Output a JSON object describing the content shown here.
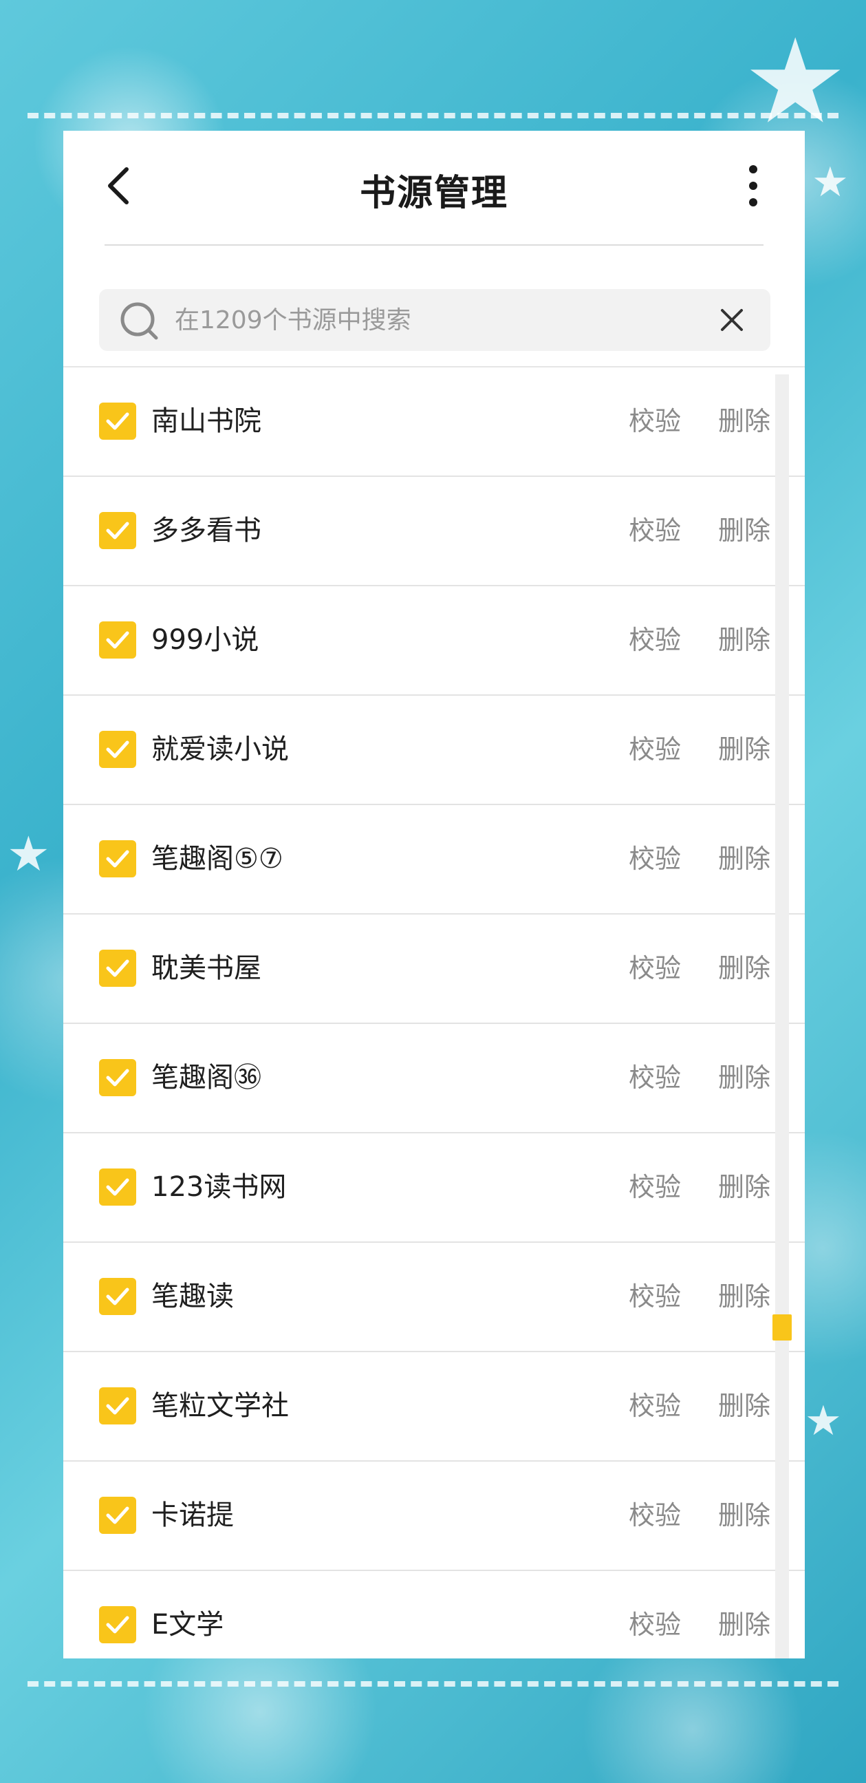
{
  "header": {
    "title": "书源管理"
  },
  "search": {
    "placeholder": "在1209个书源中搜索",
    "value": ""
  },
  "sources": [
    {
      "name": "南山书院",
      "checked": true
    },
    {
      "name": "多多看书",
      "checked": true
    },
    {
      "name": "999小说",
      "checked": true
    },
    {
      "name": "就爱读小说",
      "checked": true
    },
    {
      "name": "笔趣阁⑤⑦",
      "checked": true
    },
    {
      "name": "耽美书屋",
      "checked": true
    },
    {
      "name": "笔趣阁㊱",
      "checked": true
    },
    {
      "name": "123读书网",
      "checked": true
    },
    {
      "name": "笔趣读",
      "checked": true
    },
    {
      "name": "笔粒文学社",
      "checked": true
    },
    {
      "name": "卡诺提",
      "checked": true
    },
    {
      "name": "E文学",
      "checked": true
    }
  ],
  "row_actions": {
    "verify_label": "校验",
    "delete_label": "删除"
  },
  "colors": {
    "accent": "#f9c51a",
    "background": "#3ab2cc"
  },
  "icons": {
    "back": "back-arrow-icon",
    "more": "more-vertical-icon",
    "search": "search-icon",
    "clear": "close-icon",
    "check": "checkmark-icon"
  }
}
